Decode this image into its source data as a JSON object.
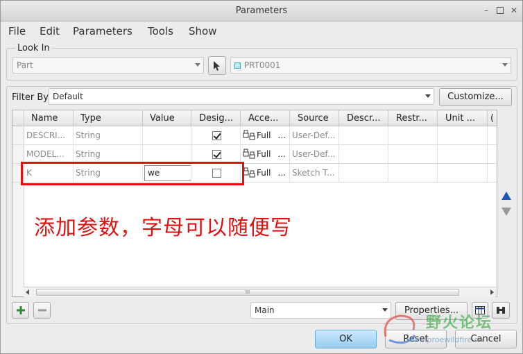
{
  "window": {
    "title": "Parameters"
  },
  "menu": [
    "File",
    "Edit",
    "Parameters",
    "Tools",
    "Show"
  ],
  "look_in": {
    "label": "Look In",
    "type_value": "Part",
    "object_value": "PRT0001"
  },
  "filter": {
    "label": "Filter By",
    "value": "Default",
    "customize_label": "Customize..."
  },
  "table": {
    "columns": [
      "Name",
      "Type",
      "Value",
      "Desig...",
      "Acce...",
      "Source",
      "Descr...",
      "Restr...",
      "Unit ..."
    ],
    "rows": [
      {
        "name": "DESCRI...",
        "type": "String",
        "value": "",
        "designate": true,
        "access": "Full",
        "source": "User-Def..."
      },
      {
        "name": "MODEL...",
        "type": "String",
        "value": "",
        "designate": true,
        "access": "Full",
        "source": "User-Def..."
      },
      {
        "name": "K",
        "type": "String",
        "value": "we",
        "designate": false,
        "access": "Full",
        "source": "Sketch T..."
      }
    ],
    "scroll_grip": "III"
  },
  "bottom": {
    "main_value": "Main",
    "properties_label": "Properties..."
  },
  "buttons": {
    "ok": "OK",
    "reset": "Reset",
    "cancel": "Cancel"
  },
  "annotation": "添加参数，字母可以随便写",
  "watermark": {
    "title": "野火论坛",
    "url": "www.proewildfire.cn"
  },
  "colors": {
    "annotation": "#e01010",
    "ok_button": "#a9d6f1",
    "add_icon": "#2e8b2e"
  }
}
